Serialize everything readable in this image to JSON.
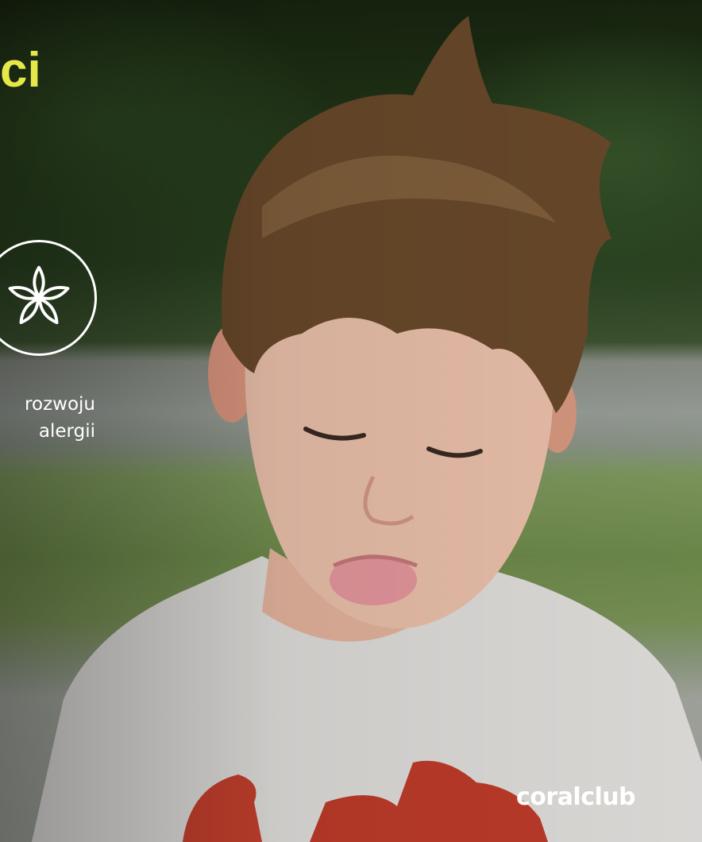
{
  "heading": {
    "text": "ci",
    "color": "#e6e84a"
  },
  "badge": {
    "icon": "flower-icon"
  },
  "caption": {
    "line1": "rozwoju",
    "line2": "alergii"
  },
  "brand": {
    "text": "coralclub"
  },
  "photo": {
    "description_icon": "photo"
  }
}
